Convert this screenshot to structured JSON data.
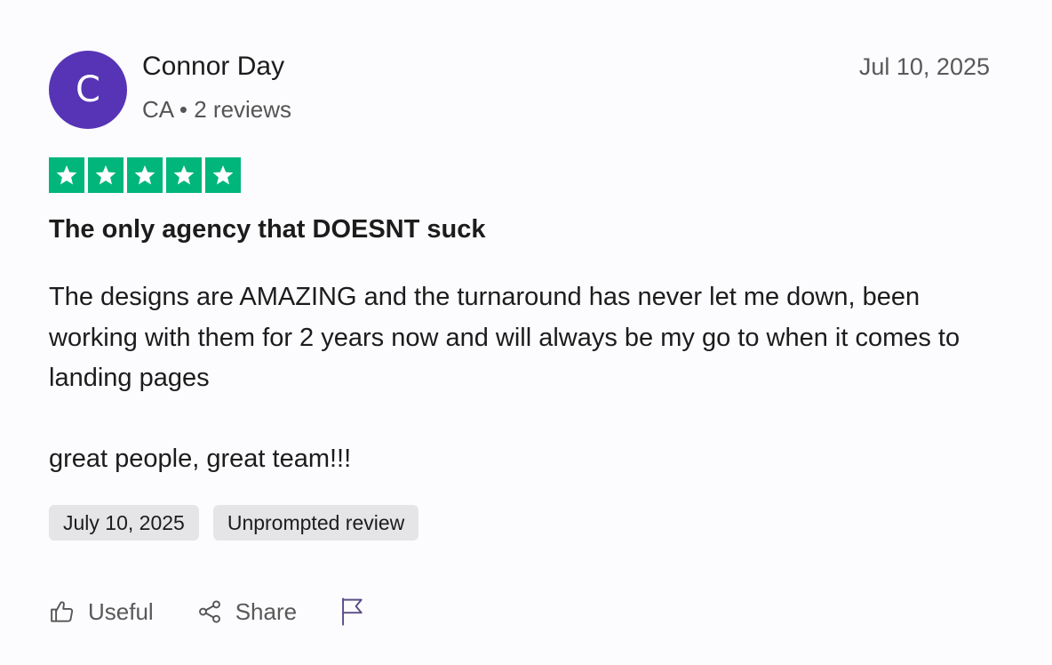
{
  "reviewer": {
    "initial": "C",
    "name": "Connor Day",
    "meta": "CA • 2 reviews",
    "avatar_color": "#5634b5"
  },
  "review": {
    "date": "Jul 10, 2025",
    "rating": 5,
    "rating_max": 5,
    "star_color": "#00b67a",
    "title": "The only agency that DOESNT suck",
    "body_paragraphs": [
      "The designs are AMAZING and the turnaround has never let me down, been working with them for 2 years now and will always be my go to when it comes to landing pages",
      "great people, great team!!!"
    ]
  },
  "tags": [
    "July 10, 2025",
    "Unprompted review"
  ],
  "actions": {
    "useful_label": "Useful",
    "useful_icon": "thumbs-up-icon",
    "share_label": "Share",
    "share_icon": "share-icon",
    "report_icon": "flag-icon"
  }
}
